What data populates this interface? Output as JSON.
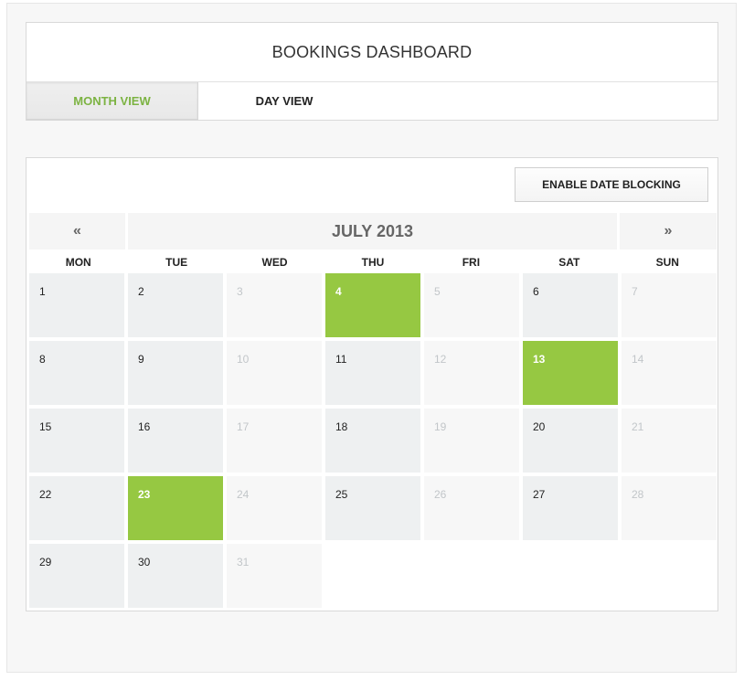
{
  "header": {
    "title": "BOOKINGS DASHBOARD",
    "tabs": [
      {
        "label": "MONTH VIEW",
        "active": true
      },
      {
        "label": "DAY VIEW",
        "active": false
      }
    ]
  },
  "calendar": {
    "enable_blocking_label": "ENABLE DATE BLOCKING",
    "prev_label": "«",
    "next_label": "»",
    "month_label": "JULY 2013",
    "weekdays": [
      "MON",
      "TUE",
      "WED",
      "THU",
      "FRI",
      "SAT",
      "SUN"
    ],
    "days": [
      {
        "day": "1",
        "state": "normal"
      },
      {
        "day": "2",
        "state": "normal"
      },
      {
        "day": "3",
        "state": "muted"
      },
      {
        "day": "4",
        "state": "booked"
      },
      {
        "day": "5",
        "state": "muted"
      },
      {
        "day": "6",
        "state": "normal"
      },
      {
        "day": "7",
        "state": "muted"
      },
      {
        "day": "8",
        "state": "normal"
      },
      {
        "day": "9",
        "state": "normal"
      },
      {
        "day": "10",
        "state": "muted"
      },
      {
        "day": "11",
        "state": "normal"
      },
      {
        "day": "12",
        "state": "muted"
      },
      {
        "day": "13",
        "state": "booked"
      },
      {
        "day": "14",
        "state": "muted"
      },
      {
        "day": "15",
        "state": "normal"
      },
      {
        "day": "16",
        "state": "normal"
      },
      {
        "day": "17",
        "state": "muted"
      },
      {
        "day": "18",
        "state": "normal"
      },
      {
        "day": "19",
        "state": "muted"
      },
      {
        "day": "20",
        "state": "normal"
      },
      {
        "day": "21",
        "state": "muted"
      },
      {
        "day": "22",
        "state": "normal"
      },
      {
        "day": "23",
        "state": "booked"
      },
      {
        "day": "24",
        "state": "muted"
      },
      {
        "day": "25",
        "state": "normal"
      },
      {
        "day": "26",
        "state": "muted"
      },
      {
        "day": "27",
        "state": "normal"
      },
      {
        "day": "28",
        "state": "muted"
      },
      {
        "day": "29",
        "state": "normal"
      },
      {
        "day": "30",
        "state": "normal"
      },
      {
        "day": "31",
        "state": "muted"
      }
    ]
  },
  "colors": {
    "accent_green": "#96c842",
    "tab_active_text": "#7cb342"
  }
}
